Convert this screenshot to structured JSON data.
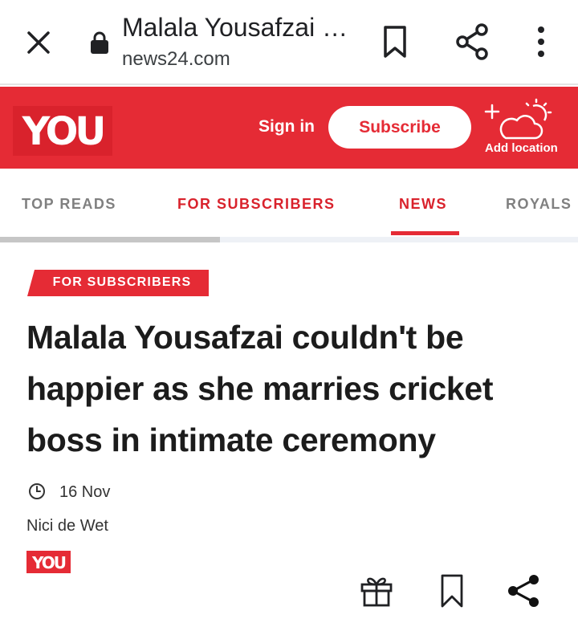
{
  "browser": {
    "page_title": "Malala Yousafzai …",
    "url": "news24.com",
    "icons": [
      "close-icon",
      "lock-icon",
      "bookmark-icon",
      "share-icon",
      "more-icon"
    ]
  },
  "header": {
    "logo": "YOU",
    "sign_in": "Sign in",
    "subscribe": "Subscribe",
    "add_location": "Add location",
    "brand_color": "#e52b35"
  },
  "tabs": [
    {
      "label": "TOP READS"
    },
    {
      "label": "FOR SUBSCRIBERS"
    },
    {
      "label": "NEWS",
      "active": true
    },
    {
      "label": "ROYALS"
    }
  ],
  "article": {
    "badge": "FOR SUBSCRIBERS",
    "headline": "Malala Yousafzai couldn't be happier as she marries cricket boss in intimate ceremony",
    "date": "16 Nov",
    "author": "Nici de Wet",
    "source_logo": "YOU"
  },
  "actions": {
    "icons": [
      "gift-icon",
      "bookmark-icon",
      "share-icon"
    ]
  }
}
